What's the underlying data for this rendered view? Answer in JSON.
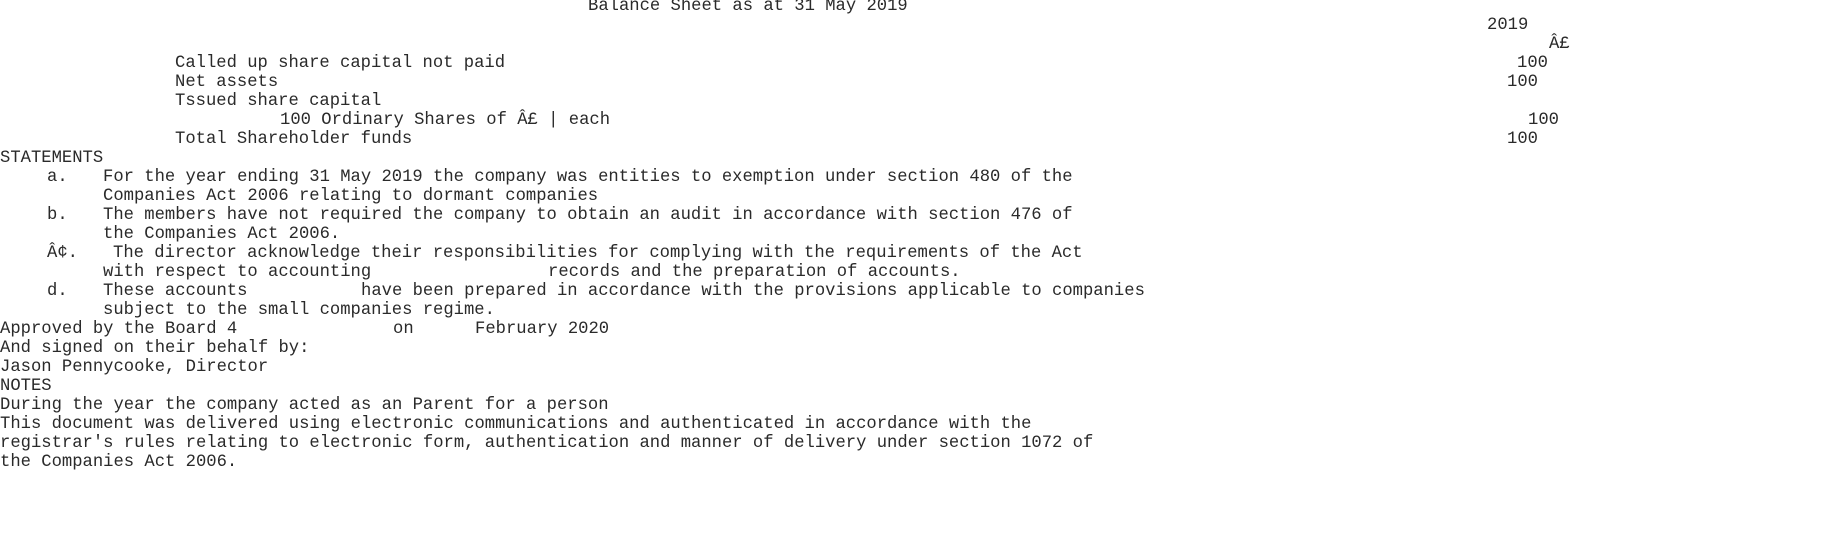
{
  "title": "Balance Sheet as at 31 May 2019",
  "column": {
    "year": "2019",
    "currency": "Â£"
  },
  "balance_rows": [
    {
      "label": "Called up share capital not paid",
      "value": "100"
    },
    {
      "label": "Net assets",
      "value": "100"
    },
    {
      "label": "Tssued share capital",
      "value": ""
    },
    {
      "label": "100 Ordinary Shares of Â£ | each",
      "value": "100"
    },
    {
      "label": "Total Shareholder funds",
      "value": "100"
    }
  ],
  "statements": {
    "heading": "STATEMENTS",
    "items": [
      {
        "marker": "a.",
        "lines": [
          "For the year ending 31 May 2019 the company was entities to exemption under section 480 of the",
          "Companies Act 2006 relating to dormant companies"
        ]
      },
      {
        "marker": "b.",
        "lines": [
          "The members have not required the company to obtain an audit in accordance with section 476 of",
          "the Companies Act 2006."
        ]
      },
      {
        "marker": "Â¢.",
        "lines": [
          "The director acknowledge their responsibilities for complying with the requirements of the Act",
          "with respect to accounting",
          "records and the preparation of accounts."
        ]
      },
      {
        "marker": "d.",
        "lines": [
          "These accounts",
          "have been prepared in accordance with the provisions applicable to companies",
          "subject to the small companies regime."
        ]
      }
    ]
  },
  "approval": {
    "approved_prefix": "Approved by the Board 4",
    "on": "on",
    "date_suffix": "February 2020",
    "signed": "And signed on their behalf by:",
    "signatory": "Jason Pennycooke, Director"
  },
  "notes": {
    "heading": "NOTES",
    "lines": [
      "During the year the company acted as an Parent for a person",
      "This document was delivered using electronic communications and authenticated in accordance with the",
      "registrar's rules relating to electronic form, authentication and manner of delivery under section 1072 of",
      "the Companies Act 2006."
    ]
  }
}
